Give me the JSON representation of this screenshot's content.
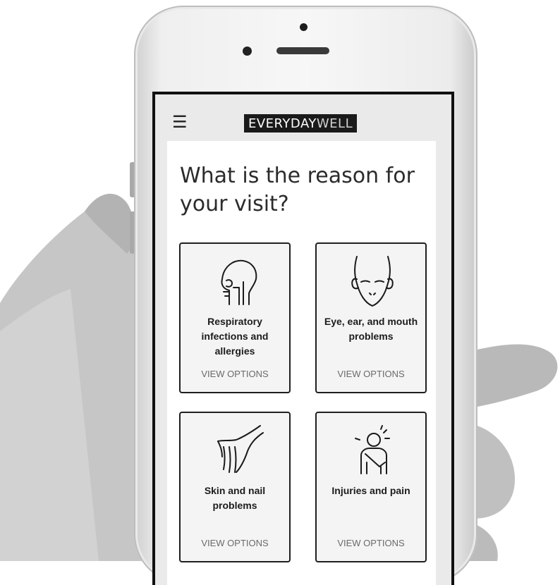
{
  "app": {
    "logo_bold": "EVERYDAY",
    "logo_light": "WELL"
  },
  "page": {
    "title": "What is the reason for your visit?"
  },
  "cards": [
    {
      "label": "Respiratory infections and allergies",
      "action": "VIEW OPTIONS",
      "icon": "respiratory-icon"
    },
    {
      "label": "Eye, ear, and mouth problems",
      "action": "VIEW OPTIONS",
      "icon": "face-icon"
    },
    {
      "label": "Skin and nail problems",
      "action": "VIEW OPTIONS",
      "icon": "hand-icon"
    },
    {
      "label": "Injuries and pain",
      "action": "VIEW OPTIONS",
      "icon": "injury-icon"
    }
  ],
  "colors": {
    "logo_bg": "#1a1a1a",
    "card_border": "#1f1f1f",
    "card_bg": "#f4f4f4"
  }
}
